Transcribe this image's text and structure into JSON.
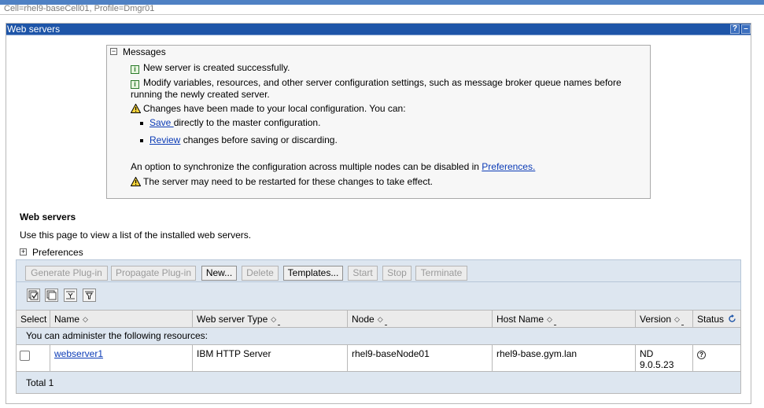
{
  "context": {
    "path": "Cell=rhel9-baseCell01, Profile=Dmgr01"
  },
  "panel": {
    "title": "Web servers",
    "help_label": "?",
    "minimize_label": "–"
  },
  "messages": {
    "heading": "Messages",
    "toggle": "−",
    "info1": "New server is created successfully.",
    "info2_line1": "Modify variables, resources, and other server configuration settings, such as message broker queue names before",
    "info2_line2": "running the newly created server.",
    "warn1": "Changes have been made to your local configuration. You can:",
    "save_link": "Save ",
    "save_rest": "directly to the master configuration.",
    "review_link": "Review",
    "review_rest": " changes before saving or discarding.",
    "sync_text": "An option to synchronize the configuration across multiple nodes can be disabled in ",
    "preferences_link": "Preferences.",
    "warn2": "The server may need to be restarted for these changes to take effect."
  },
  "section": {
    "title": "Web servers",
    "description": "Use this page to view a list of the installed web servers.",
    "preferences_toggle": "+",
    "preferences_label": "Preferences"
  },
  "toolbar": {
    "buttons": [
      {
        "label": "Generate Plug-in",
        "enabled": false
      },
      {
        "label": "Propagate Plug-in",
        "enabled": false
      },
      {
        "label": "New...",
        "enabled": true
      },
      {
        "label": "Delete",
        "enabled": false
      },
      {
        "label": "Templates...",
        "enabled": true
      },
      {
        "label": "Start",
        "enabled": false
      },
      {
        "label": "Stop",
        "enabled": false
      },
      {
        "label": "Terminate",
        "enabled": false
      }
    ],
    "icons": [
      "select-all-icon",
      "deselect-all-icon",
      "show-filter-icon",
      "clear-filter-icon"
    ]
  },
  "table": {
    "columns": [
      "Select",
      "Name",
      "Web server Type",
      "Node",
      "Host Name",
      "Version",
      "Status"
    ],
    "resource_note": "You can administer the following resources:",
    "rows": [
      {
        "name": "webserver1",
        "type": "IBM HTTP Server",
        "node": "rhel9-baseNode01",
        "host": "rhel9-base.gym.lan",
        "version_line1": "ND",
        "version_line2": "9.0.5.23",
        "status": "unknown"
      }
    ],
    "total": "Total 1"
  },
  "colors": {
    "title_bar": "#1e55a8",
    "link": "#0b3bb6",
    "toolbar_bg": "#dde6f0"
  }
}
